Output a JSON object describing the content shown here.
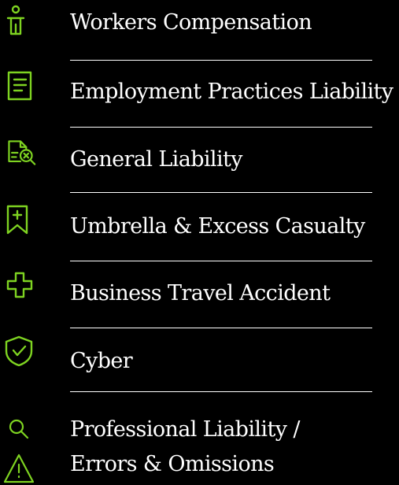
{
  "accent_color": "#7ed321",
  "items": [
    {
      "label": "Workers Compensation",
      "icon": "person-icon"
    },
    {
      "label": "Employment Practices Liability",
      "icon": "document-icon"
    },
    {
      "label": "General Liability",
      "icon": "document-search-icon"
    },
    {
      "label": "Umbrella & Excess Casualty",
      "icon": "bookmark-plus-icon"
    },
    {
      "label": "Business Travel Accident",
      "icon": "medical-cross-icon"
    },
    {
      "label": "Cyber",
      "icon": "shield-check-icon"
    },
    {
      "label": "Professional Liability /",
      "icon": "search-icon"
    },
    {
      "label": "Errors & Omissions",
      "icon": "warning-icon"
    }
  ]
}
